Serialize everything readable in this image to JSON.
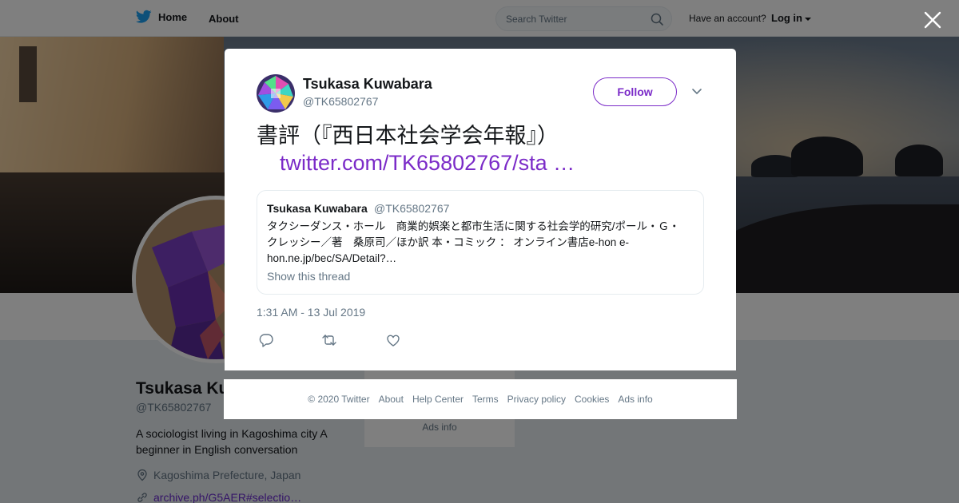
{
  "topbar": {
    "home_label": "Home",
    "about_label": "About",
    "search_placeholder": "Search Twitter",
    "account_prompt": "Have an account?",
    "login_label": "Log in"
  },
  "profile": {
    "name": "Tsukasa Kuwabara",
    "handle": "@TK65802767",
    "bio": "A sociologist living in Kagoshima city A beginner in English conversation",
    "location": "Kagoshima Prefecture, Japan",
    "link": "archive.ph/G5AER#selectio…",
    "side_ads": "Ads info"
  },
  "tweet": {
    "author_name": "Tsukasa Kuwabara",
    "author_handle": "@TK65802767",
    "follow_label": "Follow",
    "text": "書評（『西日本社会学会年報』）",
    "link": "twitter.com/TK65802767/sta …",
    "timestamp": "1:31 AM - 13 Jul 2019",
    "quote": {
      "author_name": "Tsukasa Kuwabara",
      "author_handle": "@TK65802767",
      "text": "タクシーダンス・ホール　商業的娯楽と都市生活に関する社会学的研究/ポール・Ｇ・クレッシー／著　桑原司／ほか訳 本・コミック ： オンライン書店e-hon e-hon.ne.jp/bec/SA/Detail?…",
      "show_thread": "Show this thread"
    },
    "actions": [
      "reply-icon",
      "retweet-icon",
      "like-icon"
    ]
  },
  "footer": {
    "items": [
      "© 2020 Twitter",
      "About",
      "Help Center",
      "Terms",
      "Privacy policy",
      "Cookies",
      "Ads info"
    ]
  },
  "colors": {
    "accent": "#7b2bc8",
    "twitter_blue": "#1da1f2",
    "secondary_text": "#657786",
    "overlay": "rgba(0,0,0,0.5)"
  }
}
